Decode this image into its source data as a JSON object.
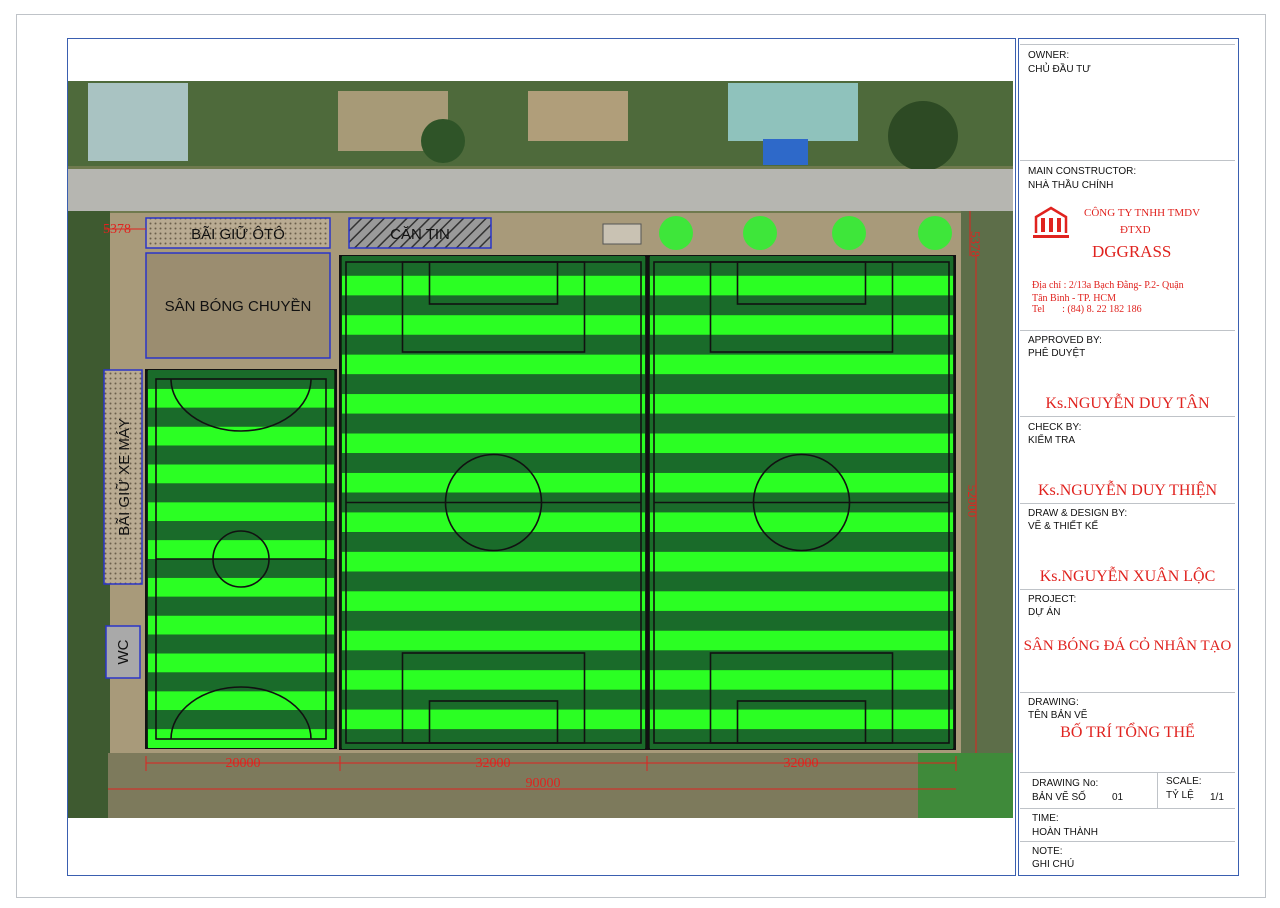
{
  "site": {
    "labels": {
      "car_parking": "BÃI GIỮ ÔTÔ",
      "canteen": "CĂN TIN",
      "volleyball": "SÂN BÓNG CHUYỀN",
      "motorbike_parking": "BÃI GIỮ XE MÁY",
      "toilet": "WC"
    },
    "dimensions": {
      "top_left": "5378",
      "top_right": "5378",
      "right_side": "52000",
      "width_left": "20000",
      "width_mid": "32000",
      "width_right": "32000",
      "total": "90000"
    }
  },
  "title_block": {
    "owner_label": "OWNER:",
    "owner_label_vn": "CHỦ ĐẦU TƯ",
    "main_constructor_label": "MAIN CONSTRUCTOR:",
    "main_constructor_label_vn": "NHÀ THẦU CHÍNH",
    "company_line1": "CÔNG TY TNHH TMDV",
    "company_line2": "ĐTXD",
    "company_name": "DGGRASS",
    "address_line1": "Địa chỉ : 2/13a Bạch Đằng- P.2- Quận",
    "address_line2": "Tân Bình - TP. HCM",
    "tel": "Tel       : (84) 8. 22 182 186",
    "approved_label": "APPROVED BY:",
    "approved_label_vn": "PHÊ DUYỆT",
    "approved_name": "Ks.NGUYỄN DUY TÂN",
    "check_label": "CHECK BY:",
    "check_label_vn": "KIỂM TRA",
    "check_name": "Ks.NGUYỄN DUY THIỆN",
    "draw_label": "DRAW & DESIGN BY:",
    "draw_label_vn": "VẼ & THIẾT KẾ",
    "draw_name": "Ks.NGUYỄN XUÂN LỘC",
    "project_label": "PROJECT:",
    "project_label_vn": "DỰ ÁN",
    "project_name": "SÂN BÓNG ĐÁ CỎ NHÂN TẠO",
    "drawing_label": "DRAWING:",
    "drawing_label_vn": "TÊN BẢN VẼ",
    "drawing_name": "BỐ TRÍ TỔNG THỂ",
    "drawing_no_label": "DRAWING No:",
    "drawing_no_label_vn": "BẢN VẼ SỐ",
    "drawing_no": "01",
    "scale_label": "SCALE:",
    "scale_label_vn": "TỶ LỆ",
    "scale": "1/1",
    "time_label": "TIME:",
    "time_label_vn": "HOÀN THÀNH",
    "note_label": "NOTE:",
    "note_label_vn": "GHI CHÚ"
  },
  "colors": {
    "turf_light": "#2bff23",
    "turf_dark": "#1a6b2a",
    "red": "#e0231f",
    "blue_box": "#2a35c8"
  }
}
